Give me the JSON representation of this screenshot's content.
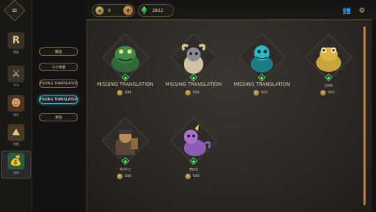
{
  "nav": {
    "items": [
      {
        "label": "图鉴",
        "icon": "R"
      },
      {
        "label": "TFTs",
        "icon": "⚔"
      },
      {
        "label": "角色",
        "icon": "☻"
      },
      {
        "label": "地图",
        "icon": "⛰"
      },
      {
        "label": "商城",
        "icon": "💰"
      }
    ]
  },
  "categories": [
    {
      "label": "精选"
    },
    {
      "label": "小小英雄"
    },
    {
      "label": "MISSING TRANSLATION"
    },
    {
      "label": "MISSING TRANSLATION"
    },
    {
      "label": "表情"
    }
  ],
  "currency": {
    "coins": "0",
    "gems": "2832"
  },
  "pets": [
    {
      "name": "MISSING TRANSLATION",
      "price": "500"
    },
    {
      "name": "MISSING TRANSLATION",
      "price": "500"
    },
    {
      "name": "MISSING TRANSLATION",
      "price": "500"
    },
    {
      "name": "沼泽蛙",
      "price": "500"
    },
    {
      "name": "铁头矿工",
      "price": "500"
    },
    {
      "name": "梦幻龙",
      "price": "500"
    }
  ],
  "colors": {
    "accent_gold": "#b08a52",
    "active_blue": "#37b6d9",
    "gem_green": "#5bd36f"
  }
}
